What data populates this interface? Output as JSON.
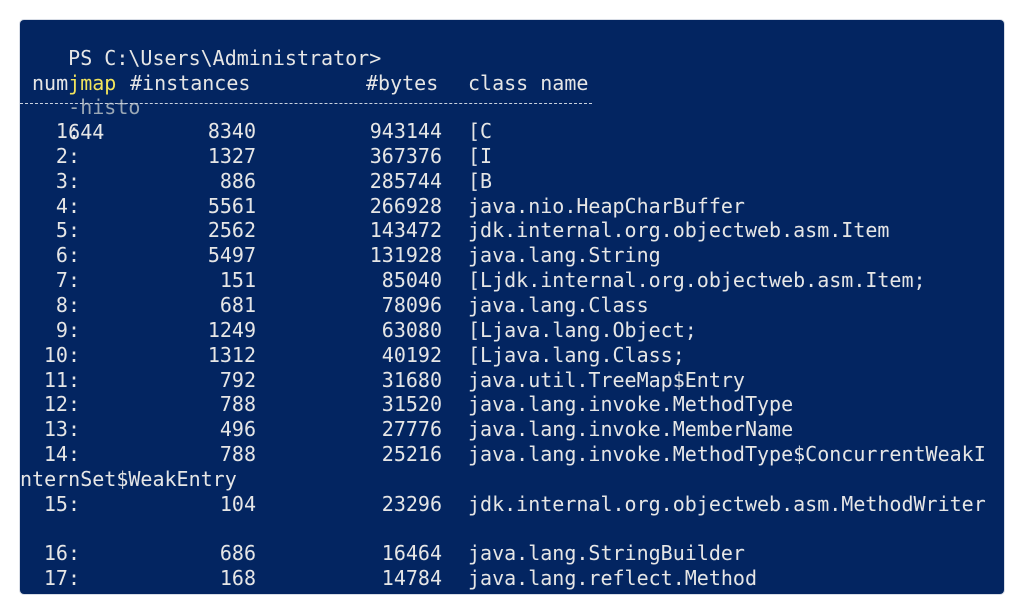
{
  "prompt": {
    "path": "PS C:\\Users\\Administrator>",
    "command": "jmap",
    "flag": "-histo",
    "pid": "644"
  },
  "header": {
    "num": "num",
    "instances": "#instances",
    "bytes": "#bytes",
    "class_name": "class name",
    "rule": "-----------------------------------------------"
  },
  "rows": [
    {
      "num": "1:",
      "instances": "8340",
      "bytes": "943144",
      "class": "[C"
    },
    {
      "num": "2:",
      "instances": "1327",
      "bytes": "367376",
      "class": "[I"
    },
    {
      "num": "3:",
      "instances": "886",
      "bytes": "285744",
      "class": "[B"
    },
    {
      "num": "4:",
      "instances": "5561",
      "bytes": "266928",
      "class": "java.nio.HeapCharBuffer"
    },
    {
      "num": "5:",
      "instances": "2562",
      "bytes": "143472",
      "class": "jdk.internal.org.objectweb.asm.Item"
    },
    {
      "num": "6:",
      "instances": "5497",
      "bytes": "131928",
      "class": "java.lang.String"
    },
    {
      "num": "7:",
      "instances": "151",
      "bytes": "85040",
      "class": "[Ljdk.internal.org.objectweb.asm.Item;"
    },
    {
      "num": "8:",
      "instances": "681",
      "bytes": "78096",
      "class": "java.lang.Class"
    },
    {
      "num": "9:",
      "instances": "1249",
      "bytes": "63080",
      "class": "[Ljava.lang.Object;"
    },
    {
      "num": "10:",
      "instances": "1312",
      "bytes": "40192",
      "class": "[Ljava.lang.Class;"
    },
    {
      "num": "11:",
      "instances": "792",
      "bytes": "31680",
      "class": "java.util.TreeMap$Entry"
    },
    {
      "num": "12:",
      "instances": "788",
      "bytes": "31520",
      "class": "java.lang.invoke.MethodType"
    },
    {
      "num": "13:",
      "instances": "496",
      "bytes": "27776",
      "class": "java.lang.invoke.MemberName"
    },
    {
      "num": "14:",
      "instances": "788",
      "bytes": "25216",
      "class": "java.lang.invoke.MethodType$ConcurrentWeakI"
    },
    {
      "wrap": "nternSet$WeakEntry"
    },
    {
      "num": "15:",
      "instances": "104",
      "bytes": "23296",
      "class": "jdk.internal.org.objectweb.asm.MethodWriter"
    },
    {
      "blank": true
    },
    {
      "num": "16:",
      "instances": "686",
      "bytes": "16464",
      "class": "java.lang.StringBuilder"
    },
    {
      "num": "17:",
      "instances": "168",
      "bytes": "14784",
      "class": "java.lang.reflect.Method"
    }
  ],
  "colors": {
    "background": "#032561",
    "text": "#e6e6e6",
    "command": "#f2e45c",
    "flag": "#9aa7b5"
  }
}
